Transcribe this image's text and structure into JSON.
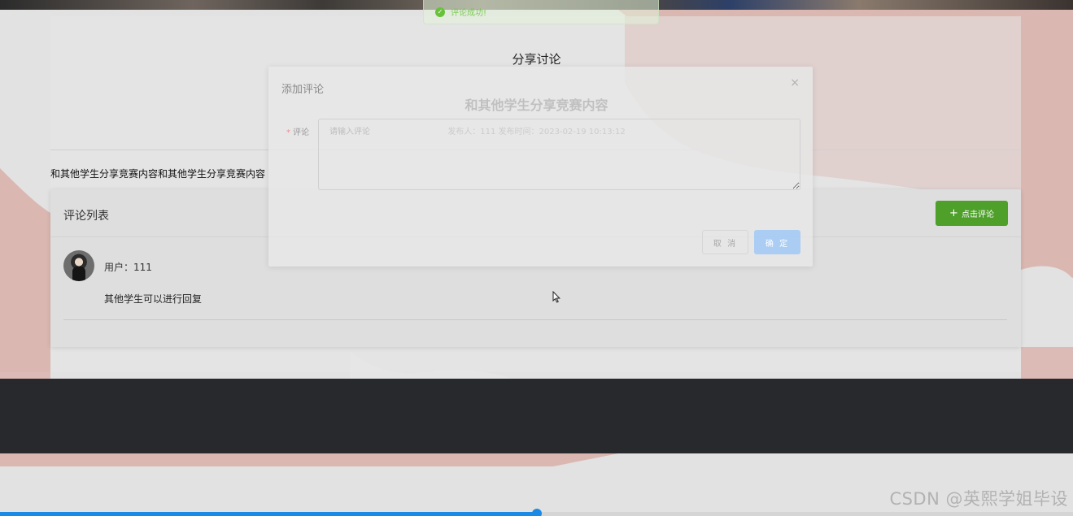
{
  "toast": {
    "message": "评论成功!"
  },
  "page": {
    "title": "分享讨论",
    "post_title": "和其他学生分享竞赛内容",
    "post_meta": "发布人：111  发布时间：2023-02-19 10:13:12",
    "post_body": "和其他学生分享竞赛内容和其他学生分享竞赛内容"
  },
  "comments": {
    "header": "评论列表",
    "add_button": "点击评论",
    "items": [
      {
        "user": "用户：111",
        "text": "其他学生可以进行回复"
      }
    ]
  },
  "dialog": {
    "title": "添加评论",
    "close_symbol": "×",
    "field_label": "评论",
    "required_mark": "*",
    "placeholder": "请输入评论",
    "cancel_label": "取 消",
    "confirm_label": "确 定"
  },
  "video_progress": 0.5,
  "watermark": "CSDN @英熙学姐毕设",
  "colors": {
    "primary_green": "#4ea02b",
    "progress_blue": "#1b8ae6",
    "footer_dark": "#27292c",
    "pink_blob": "#dbb7b1"
  },
  "icons": {
    "toast": "check-circle-icon",
    "add": "plus-icon",
    "close": "close-icon",
    "cursor": "mouse-pointer-icon"
  }
}
